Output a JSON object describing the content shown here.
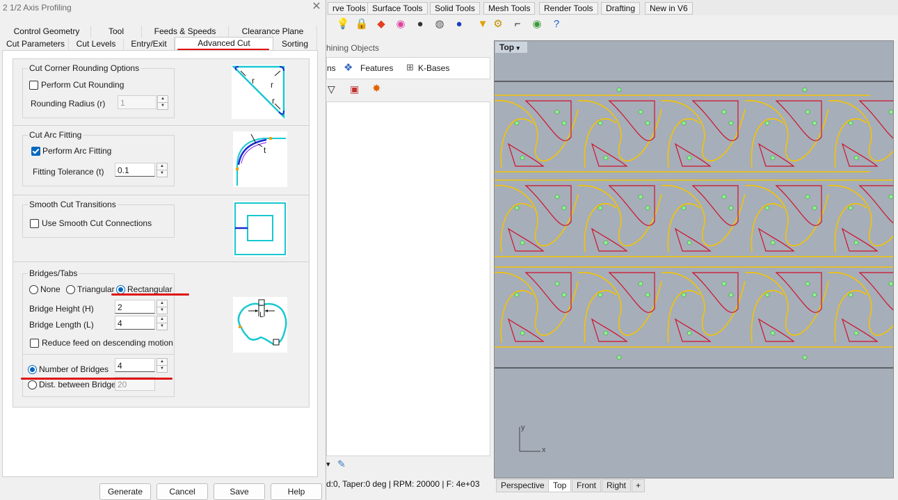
{
  "dialog": {
    "title": "2 1/2 Axis Profiling",
    "close": "✕",
    "tabs_row1": [
      "Control Geometry",
      "Tool",
      "Feeds & Speeds",
      "Clearance Plane"
    ],
    "tabs_row2": [
      "Cut Parameters",
      "Cut Levels",
      "Entry/Exit",
      "Advanced Cut Parameters",
      "Sorting"
    ],
    "active_tab": "Advanced Cut Parameters",
    "corner": {
      "group_title": "Cut Corner Rounding Options",
      "perform_label": "Perform Cut Rounding",
      "perform_checked": false,
      "radius_label": "Rounding Radius (r)",
      "radius_value": "1",
      "illus_r": "r"
    },
    "arc": {
      "group_title": "Cut Arc Fitting",
      "perform_label": "Perform Arc Fitting",
      "perform_checked": true,
      "tolerance_label": "Fitting Tolerance (t)",
      "tolerance_value": "0.1",
      "illus_t": "t"
    },
    "smooth": {
      "group_title": "Smooth Cut Transitions",
      "use_label": "Use Smooth Cut Connections",
      "use_checked": false
    },
    "bridges": {
      "group_title": "Bridges/Tabs",
      "opt_none": "None",
      "opt_triangular": "Triangular",
      "opt_rectangular": "Rectangular",
      "selected": "Rectangular",
      "height_label": "Bridge Height (H)",
      "height_value": "2",
      "length_label": "Bridge Length (L)",
      "length_value": "4",
      "reduce_label": "Reduce feed on descending motion",
      "reduce_checked": false,
      "num_label": "Number of Bridges",
      "num_value": "4",
      "dist_label": "Dist. between Bridges",
      "dist_value": "20",
      "illus_h": "H",
      "illus_l": "L"
    },
    "buttons": {
      "generate": "Generate",
      "cancel": "Cancel",
      "save": "Save",
      "help": "Help"
    }
  },
  "app": {
    "menu_tabs": [
      "rve Tools",
      "Surface Tools",
      "Solid Tools",
      "Mesh Tools",
      "Render Tools",
      "Drafting",
      "New in V6"
    ],
    "panel_header": "hining Objects",
    "panel_tabs": [
      "ns",
      "Features",
      "K-Bases"
    ],
    "status_text": "d:0, Taper:0 deg | RPM: 20000 | F: 4e+03",
    "viewport_label": "Top",
    "axis_x": "x",
    "axis_y": "y",
    "view_tabs": [
      "Perspective",
      "Top",
      "Front",
      "Right"
    ],
    "add_view": "+",
    "colors": {
      "curve": "#f5c400",
      "toolpath": "#d0102a",
      "point": "#8cf58c",
      "viewport_bg": "#a6aeb9",
      "accent": "#0067c0",
      "underline": "#e01010"
    }
  }
}
